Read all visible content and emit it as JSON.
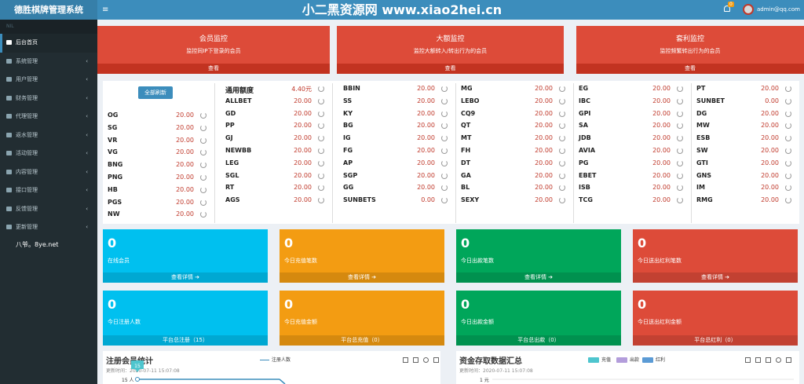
{
  "app": {
    "title": "德胜棋牌管理系统",
    "menu_toggle": "≡",
    "watermark": "小二黑资源网 www.xiao2hei.cn",
    "notif_count": "0",
    "user": "admin@qq.com"
  },
  "sidebar": {
    "header": "NIL",
    "items": [
      {
        "label": "后台首页",
        "icon": "dashboard-icon",
        "active": true,
        "chev": ""
      },
      {
        "label": "系统管理",
        "icon": "gear-icon",
        "chev": "‹"
      },
      {
        "label": "用户管理",
        "icon": "users-icon",
        "chev": "‹"
      },
      {
        "label": "财务管理",
        "icon": "wallet-icon",
        "chev": "‹"
      },
      {
        "label": "代理管理",
        "icon": "calendar-icon",
        "chev": "‹"
      },
      {
        "label": "返水管理",
        "icon": "recycle-icon",
        "chev": "‹"
      },
      {
        "label": "活动管理",
        "icon": "calendar-icon",
        "chev": "‹"
      },
      {
        "label": "内容管理",
        "icon": "map-icon",
        "chev": "‹"
      },
      {
        "label": "接口管理",
        "icon": "link-icon",
        "chev": "‹"
      },
      {
        "label": "反馈管理",
        "icon": "comment-icon",
        "chev": "‹"
      },
      {
        "label": "更新管理",
        "icon": "refresh-icon",
        "chev": "‹"
      }
    ],
    "note": "八爷。8ye.net"
  },
  "monitors": [
    {
      "title": "会员监控",
      "subtitle": "监控同IP下登录的会员",
      "link": "查看"
    },
    {
      "title": "大额监控",
      "subtitle": "监控大额转入/转出行为的会员",
      "link": "查看"
    },
    {
      "title": "套利监控",
      "subtitle": "监控频繁转出行为的会员",
      "link": "查看"
    }
  ],
  "balance": {
    "refresh_all": "全部刷新",
    "general_label": "通用额度",
    "general_value": "4.40元",
    "col1": [
      {
        "name": "OG",
        "value": "20.00"
      },
      {
        "name": "SG",
        "value": "20.00"
      },
      {
        "name": "VR",
        "value": "20.00"
      },
      {
        "name": "VG",
        "value": "20.00"
      },
      {
        "name": "BNG",
        "value": "20.00"
      },
      {
        "name": "PNG",
        "value": "20.00"
      },
      {
        "name": "HB",
        "value": "20.00"
      },
      {
        "name": "PGS",
        "value": "20.00"
      },
      {
        "name": "NW",
        "value": "20.00"
      }
    ],
    "col2": [
      {
        "name": "ALLBET",
        "value": "20.00"
      },
      {
        "name": "GD",
        "value": "20.00"
      },
      {
        "name": "PP",
        "value": "20.00"
      },
      {
        "name": "GJ",
        "value": "20.00"
      },
      {
        "name": "NEWBB",
        "value": "20.00"
      },
      {
        "name": "LEG",
        "value": "20.00"
      },
      {
        "name": "SGL",
        "value": "20.00"
      },
      {
        "name": "RT",
        "value": "20.00"
      },
      {
        "name": "AGS",
        "value": "20.00"
      }
    ],
    "col3": [
      {
        "name": "BBIN",
        "value": "20.00"
      },
      {
        "name": "SS",
        "value": "20.00"
      },
      {
        "name": "KY",
        "value": "20.00"
      },
      {
        "name": "BG",
        "value": "20.00"
      },
      {
        "name": "IG",
        "value": "20.00"
      },
      {
        "name": "FG",
        "value": "20.00"
      },
      {
        "name": "AP",
        "value": "20.00"
      },
      {
        "name": "SGP",
        "value": "20.00"
      },
      {
        "name": "GG",
        "value": "20.00"
      },
      {
        "name": "SUNBETS",
        "value": "0.00"
      }
    ],
    "col4": [
      {
        "name": "MG",
        "value": "20.00"
      },
      {
        "name": "LEBO",
        "value": "20.00"
      },
      {
        "name": "CQ9",
        "value": "20.00"
      },
      {
        "name": "QT",
        "value": "20.00"
      },
      {
        "name": "MT",
        "value": "20.00"
      },
      {
        "name": "FH",
        "value": "20.00"
      },
      {
        "name": "DT",
        "value": "20.00"
      },
      {
        "name": "GA",
        "value": "20.00"
      },
      {
        "name": "BL",
        "value": "20.00"
      },
      {
        "name": "SEXY",
        "value": "20.00"
      }
    ],
    "col5": [
      {
        "name": "EG",
        "value": "20.00"
      },
      {
        "name": "IBC",
        "value": "20.00"
      },
      {
        "name": "GPI",
        "value": "20.00"
      },
      {
        "name": "SA",
        "value": "20.00"
      },
      {
        "name": "JDB",
        "value": "20.00"
      },
      {
        "name": "AVIA",
        "value": "20.00"
      },
      {
        "name": "PG",
        "value": "20.00"
      },
      {
        "name": "EBET",
        "value": "20.00"
      },
      {
        "name": "ISB",
        "value": "20.00"
      },
      {
        "name": "TCG",
        "value": "20.00"
      }
    ],
    "col6": [
      {
        "name": "PT",
        "value": "20.00"
      },
      {
        "name": "SUNBET",
        "value": "0.00"
      },
      {
        "name": "DG",
        "value": "20.00"
      },
      {
        "name": "MW",
        "value": "20.00"
      },
      {
        "name": "ESB",
        "value": "20.00"
      },
      {
        "name": "SW",
        "value": "20.00"
      },
      {
        "name": "GTI",
        "value": "20.00"
      },
      {
        "name": "GNS",
        "value": "20.00"
      },
      {
        "name": "IM",
        "value": "20.00"
      },
      {
        "name": "RMG",
        "value": "20.00"
      }
    ]
  },
  "stats": [
    {
      "value": "0",
      "label": "在线会员",
      "footer": "查看详情 ➔",
      "color": "#00c0ef"
    },
    {
      "value": "0",
      "label": "今日充值笔数",
      "footer": "查看详情 ➔",
      "color": "#f39c12"
    },
    {
      "value": "0",
      "label": "今日出款笔数",
      "footer": "查看详情 ➔",
      "color": "#00a65a"
    },
    {
      "value": "0",
      "label": "今日送出红利笔数",
      "footer": "查看详情 ➔",
      "color": "#dd4b39"
    },
    {
      "value": "0",
      "label": "今日注册人数",
      "footer": "平台总注册（15）",
      "color": "#00c0ef"
    },
    {
      "value": "0",
      "label": "今日充值金额",
      "footer": "平台总充值（0）",
      "color": "#f39c12"
    },
    {
      "value": "0",
      "label": "今日出款金额",
      "footer": "平台总出款（0）",
      "color": "#00a65a"
    },
    {
      "value": "0",
      "label": "今日送出红利金额",
      "footer": "平台总红利（0）",
      "color": "#dd4b39"
    }
  ],
  "charts": {
    "reg": {
      "title": "注册会员统计",
      "date": "更新时间：2020-07-11 15:07:08",
      "legend": "注册人数",
      "y_tick": "15 人",
      "marker": "15"
    },
    "money": {
      "title": "资金存取数据汇总",
      "date": "更新时间：2020-07-11 15:07:08",
      "legend": [
        "充值",
        "出款",
        "红利"
      ],
      "legend_colors": [
        "#4ec5ce",
        "#b39ddb",
        "#5b9bd5"
      ],
      "y_tick": "1 元"
    }
  },
  "chart_data": [
    {
      "type": "line",
      "title": "注册会员统计",
      "series": [
        {
          "name": "注册人数",
          "values": [
            15,
            15
          ]
        }
      ],
      "y_tick_label": "15 人"
    },
    {
      "type": "bar",
      "title": "资金存取数据汇总",
      "series": [
        {
          "name": "充值",
          "values": []
        },
        {
          "name": "出款",
          "values": []
        },
        {
          "name": "红利",
          "values": []
        }
      ],
      "y_tick_label": "1 元"
    }
  ]
}
